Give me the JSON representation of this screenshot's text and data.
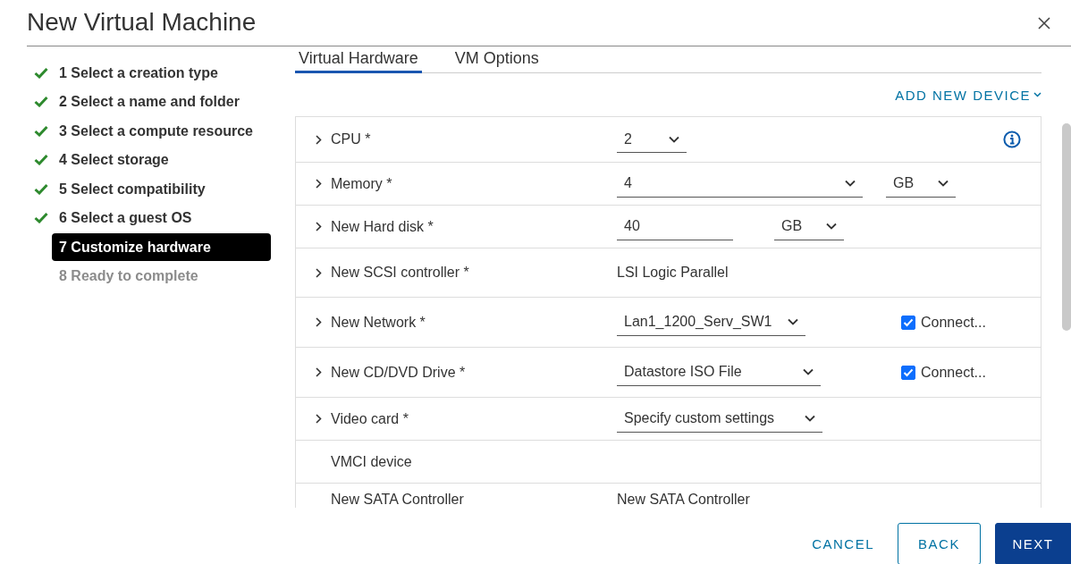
{
  "dialog": {
    "title": "New Virtual Machine"
  },
  "steps": [
    {
      "label": "1 Select a creation type",
      "done": true,
      "selected": false,
      "disabled": false
    },
    {
      "label": "2 Select a name and folder",
      "done": true,
      "selected": false,
      "disabled": false
    },
    {
      "label": "3 Select a compute resource",
      "done": true,
      "selected": false,
      "disabled": false
    },
    {
      "label": "4 Select storage",
      "done": true,
      "selected": false,
      "disabled": false
    },
    {
      "label": "5 Select compatibility",
      "done": true,
      "selected": false,
      "disabled": false
    },
    {
      "label": "6 Select a guest OS",
      "done": true,
      "selected": false,
      "disabled": false
    },
    {
      "label": "7 Customize hardware",
      "done": false,
      "selected": true,
      "disabled": false
    },
    {
      "label": "8 Ready to complete",
      "done": false,
      "selected": false,
      "disabled": true
    }
  ],
  "tabs": [
    {
      "label": "Virtual Hardware",
      "selected": true
    },
    {
      "label": "VM Options",
      "selected": false
    }
  ],
  "add_device": "ADD NEW DEVICE",
  "devices": [
    {
      "label": "CPU *",
      "expandable": true,
      "controls": [
        {
          "kind": "select",
          "value": "2"
        },
        {
          "kind": "info"
        }
      ]
    },
    {
      "label": "Memory *",
      "expandable": true,
      "controls": [
        {
          "kind": "select",
          "value": "4"
        },
        {
          "kind": "select",
          "value": "GB"
        }
      ]
    },
    {
      "label": "New Hard disk *",
      "expandable": true,
      "controls": [
        {
          "kind": "input",
          "value": "40"
        },
        {
          "kind": "select",
          "value": "GB"
        }
      ]
    },
    {
      "label": "New SCSI controller *",
      "expandable": true,
      "controls": [
        {
          "kind": "text",
          "value": "LSI Logic Parallel"
        }
      ]
    },
    {
      "label": "New Network *",
      "expandable": true,
      "controls": [
        {
          "kind": "select",
          "value": "Lan1_1200_Serv_SW1"
        },
        {
          "kind": "checkbox",
          "label": "Connect...",
          "checked": true
        }
      ]
    },
    {
      "label": "New CD/DVD Drive *",
      "expandable": true,
      "controls": [
        {
          "kind": "select",
          "value": "Datastore ISO File"
        },
        {
          "kind": "checkbox",
          "label": "Connect...",
          "checked": true
        }
      ]
    },
    {
      "label": "Video card *",
      "expandable": true,
      "controls": [
        {
          "kind": "select",
          "value": "Specify custom settings"
        }
      ]
    },
    {
      "label": "VMCI device",
      "expandable": false
    },
    {
      "label": "New SATA Controller",
      "expandable": false,
      "controls": [
        {
          "kind": "text",
          "value": "New SATA Controller"
        }
      ]
    }
  ],
  "buttons": [
    {
      "label": "CANCEL",
      "kind": "link"
    },
    {
      "label": "BACK",
      "kind": "outline"
    },
    {
      "label": "NEXT",
      "kind": "primary"
    }
  ]
}
